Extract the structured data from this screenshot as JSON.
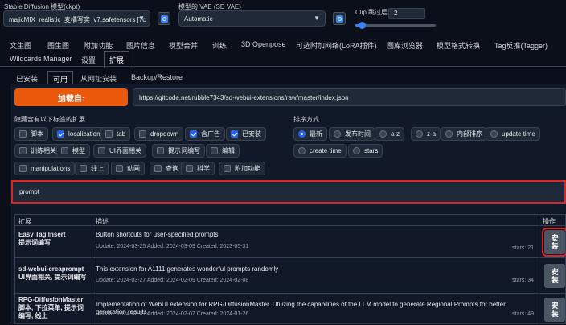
{
  "top": {
    "ckpt_label": "Stable Diffusion 模型(ckpt)",
    "ckpt_value": "majicMIX_realistic_麦橘写实_v7.safetensors [7c",
    "vae_label": "模型的 VAE (SD VAE)",
    "vae_value": "Automatic",
    "clip_label": "Clip 跳过层",
    "clip_value": "2",
    "clip_fraction": 0.08
  },
  "tabs": [
    "文生图",
    "图生图",
    "附加功能",
    "图片信息",
    "模型合并",
    "训练",
    "3D Openpose",
    "可选附加网络(LoRA插件)",
    "图库浏览器",
    "模型格式转换",
    "Tag反推(Tagger)",
    "Wildcards Manager",
    "设置",
    "扩展"
  ],
  "subtabs": [
    "已安装",
    "可用",
    "从网址安装",
    "Backup/Restore"
  ],
  "load_button": "加载自:",
  "url_value": "https://gitcode.net/rubble7343/sd-webui-extensions/raw/master/index.json",
  "hide_label": "隐藏含有以下标签的扩展",
  "hide_tags": [
    {
      "label": "脚本",
      "checked": false
    },
    {
      "label": "localization",
      "checked": true
    },
    {
      "label": "tab",
      "checked": false
    },
    {
      "label": "dropdown",
      "checked": false
    },
    {
      "label": "含广告",
      "checked": true
    },
    {
      "label": "已安装",
      "checked": true
    },
    {
      "label": "训练相关",
      "checked": false
    },
    {
      "label": "模型",
      "checked": false
    },
    {
      "label": "UI界面相关",
      "checked": false
    },
    {
      "label": "提示词编写",
      "checked": false
    },
    {
      "label": "编辑",
      "checked": false
    },
    {
      "label": "manipulations",
      "checked": false
    },
    {
      "label": "线上",
      "checked": false
    },
    {
      "label": "动画",
      "checked": false
    },
    {
      "label": "查询",
      "checked": false
    },
    {
      "label": "科学",
      "checked": false
    },
    {
      "label": "附加功能",
      "checked": false
    }
  ],
  "sort_label": "排序方式",
  "sort_options": [
    {
      "label": "最新",
      "selected": true
    },
    {
      "label": "发布时间",
      "selected": false
    },
    {
      "label": "a-z",
      "selected": false
    },
    {
      "label": "z-a",
      "selected": false
    },
    {
      "label": "内部排序",
      "selected": false
    },
    {
      "label": "update time",
      "selected": false
    },
    {
      "label": "create time",
      "selected": false
    },
    {
      "label": "stars",
      "selected": false
    }
  ],
  "search_value": "prompt",
  "table": {
    "headers": [
      "扩展",
      "描述",
      "操作"
    ],
    "rows": [
      {
        "name": "Easy Tag Insert",
        "tags": "提示词编写",
        "desc": "Button shortcuts for user-specified prompts",
        "meta": "Update: 2024-03-25 Added: 2024-03-09 Created: 2023-05-31",
        "stars": "stars: 21",
        "action": "安装"
      },
      {
        "name": "sd-webui-creaprompt",
        "tags": "UI界面相关, 提示词编写",
        "desc": "This extension for A1111 generates wonderful prompts randomly",
        "meta": "Update: 2024-03-27 Added: 2024-02-09 Created: 2024-02-08",
        "stars": "stars: 34",
        "action": "安装"
      },
      {
        "name": "RPG-DiffusionMaster",
        "tags": "脚本, 下拉菜单, 提示词编写, 线上",
        "desc": "Implementation of WebUI extension for RPG-DiffusionMaster. Utilizing the capabilities of the LLM model to generate Regional Prompts for better generation results.",
        "meta": "Update: 2024-02-07 Added: 2024-02-07 Created: 2024-01-26",
        "stars": "stars: 49",
        "action": "安装"
      }
    ]
  }
}
